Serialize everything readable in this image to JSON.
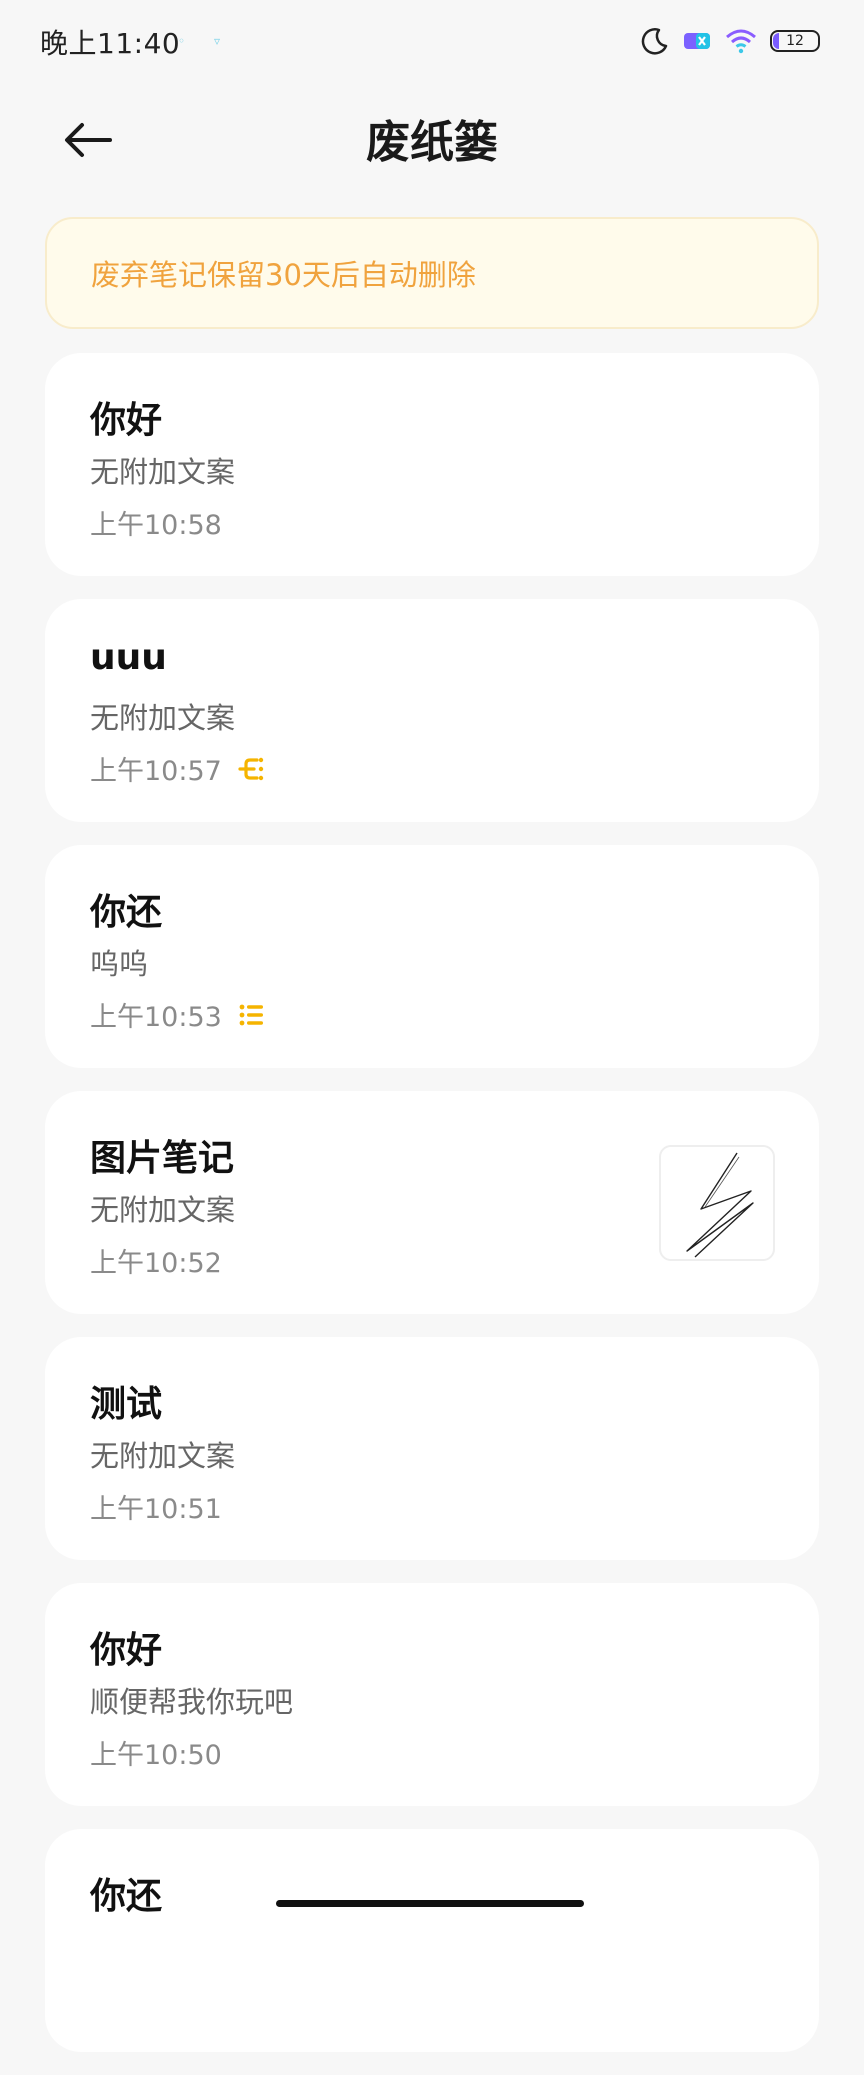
{
  "status_bar": {
    "time": "晚上11:40",
    "battery_level": "12"
  },
  "header": {
    "title": "废纸篓"
  },
  "notice": {
    "text": "废弃笔记保留30天后自动删除"
  },
  "notes": [
    {
      "title": "你好",
      "desc": "无附加文案",
      "time": "上午10:58"
    },
    {
      "title": "uuu",
      "desc": "无附加文案",
      "time": "上午10:57",
      "icon": "mind-map-icon"
    },
    {
      "title": "你还",
      "desc": "呜呜",
      "time": "上午10:53",
      "icon": "checklist-icon"
    },
    {
      "title": "图片笔记",
      "desc": "无附加文案",
      "time": "上午10:52",
      "thumbnail": "handwriting-sketch"
    },
    {
      "title": "测试",
      "desc": "无附加文案",
      "time": "上午10:51"
    },
    {
      "title": "你好",
      "desc": "顺便帮我你玩吧",
      "time": "上午10:50"
    },
    {
      "title": "你还",
      "desc": "",
      "time": ""
    }
  ],
  "colors": {
    "background": "#f7f7f7",
    "notice_bg": "#fffbeb",
    "notice_text": "#f0a33e",
    "accent_icon": "#f5b400"
  }
}
